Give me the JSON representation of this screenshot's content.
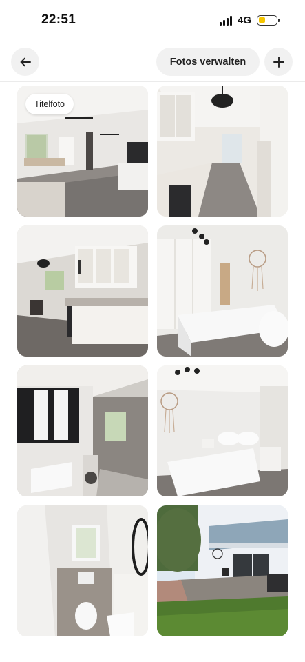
{
  "status_bar": {
    "time": "22:51",
    "network": "4G",
    "battery_color": "#f6c600"
  },
  "nav": {
    "back_icon": "arrow-left-icon",
    "manage_label": "Fotos verwalten",
    "add_icon": "plus-icon"
  },
  "photos": [
    {
      "subject": "living-room",
      "badge": "Titelfoto"
    },
    {
      "subject": "kitchen-hallway"
    },
    {
      "subject": "kitchen"
    },
    {
      "subject": "bedroom-wardrobe"
    },
    {
      "subject": "bathroom"
    },
    {
      "subject": "bedroom"
    },
    {
      "subject": "toilet-room"
    },
    {
      "subject": "building-exterior-garden"
    }
  ]
}
